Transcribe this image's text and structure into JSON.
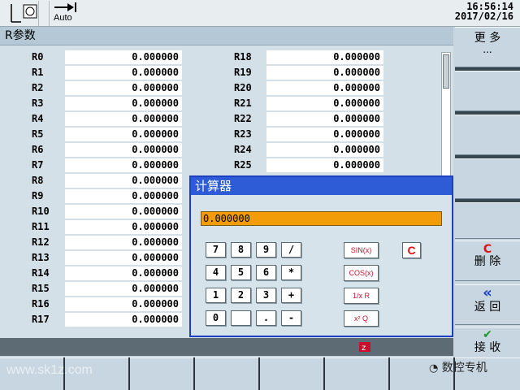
{
  "header": {
    "mode_label": "Auto",
    "time": "16:56:14",
    "date": "2017/02/16"
  },
  "title": "R参数",
  "params": [
    {
      "label": "R0",
      "value": "0.000000"
    },
    {
      "label": "R1",
      "value": "0.000000"
    },
    {
      "label": "R2",
      "value": "0.000000"
    },
    {
      "label": "R3",
      "value": "0.000000"
    },
    {
      "label": "R4",
      "value": "0.000000"
    },
    {
      "label": "R5",
      "value": "0.000000"
    },
    {
      "label": "R6",
      "value": "0.000000"
    },
    {
      "label": "R7",
      "value": "0.000000"
    },
    {
      "label": "R8",
      "value": "0.000000"
    },
    {
      "label": "R9",
      "value": "0.000000"
    },
    {
      "label": "R10",
      "value": "0.000000"
    },
    {
      "label": "R11",
      "value": "0.000000"
    },
    {
      "label": "R12",
      "value": "0.000000"
    },
    {
      "label": "R13",
      "value": "0.000000"
    },
    {
      "label": "R14",
      "value": "0.000000"
    },
    {
      "label": "R15",
      "value": "0.000000"
    },
    {
      "label": "R16",
      "value": "0.000000"
    },
    {
      "label": "R17",
      "value": "0.000000"
    },
    {
      "label": "R18",
      "value": "0.000000"
    },
    {
      "label": "R19",
      "value": "0.000000"
    },
    {
      "label": "R20",
      "value": "0.000000"
    },
    {
      "label": "R21",
      "value": "0.000000"
    },
    {
      "label": "R22",
      "value": "0.000000"
    },
    {
      "label": "R23",
      "value": "0.000000"
    },
    {
      "label": "R24",
      "value": "0.000000"
    },
    {
      "label": "R25",
      "value": "0.000000"
    }
  ],
  "calculator": {
    "title": "计算器",
    "display": "0.000000",
    "keys": [
      [
        "7",
        "8",
        "9",
        "/"
      ],
      [
        "4",
        "5",
        "6",
        "*"
      ],
      [
        "1",
        "2",
        "3",
        "+"
      ],
      [
        "0",
        "",
        ".",
        "-"
      ]
    ],
    "functions": [
      "SIN(x)",
      "COS(x)",
      "1/x R",
      "x² Q"
    ],
    "clear": "C"
  },
  "softkeys": {
    "more_1": "更 多",
    "more_2": "...",
    "delete_icon": "C",
    "delete": "删 除",
    "back_icon": "«",
    "back": "返 回",
    "accept_icon": "✔",
    "accept": "接 收"
  },
  "watermark": {
    "left": "www.sk1z.com",
    "right": "数控专机"
  },
  "colors": {
    "accent": "#f39c0a",
    "dialog_title": "#2e5bd6",
    "delete_red": "#d11",
    "back_blue": "#1a3fc7",
    "accept_green": "#1a9a2a"
  }
}
